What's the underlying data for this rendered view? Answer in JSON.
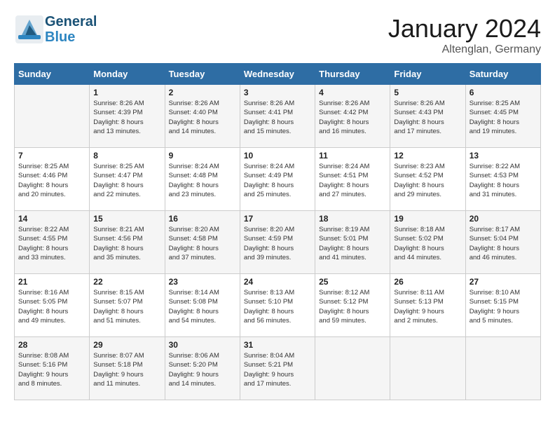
{
  "header": {
    "logo_line1": "General",
    "logo_line2": "Blue",
    "month": "January 2024",
    "location": "Altenglan, Germany"
  },
  "days_of_week": [
    "Sunday",
    "Monday",
    "Tuesday",
    "Wednesday",
    "Thursday",
    "Friday",
    "Saturday"
  ],
  "weeks": [
    [
      {
        "day": "",
        "info": ""
      },
      {
        "day": "1",
        "info": "Sunrise: 8:26 AM\nSunset: 4:39 PM\nDaylight: 8 hours\nand 13 minutes."
      },
      {
        "day": "2",
        "info": "Sunrise: 8:26 AM\nSunset: 4:40 PM\nDaylight: 8 hours\nand 14 minutes."
      },
      {
        "day": "3",
        "info": "Sunrise: 8:26 AM\nSunset: 4:41 PM\nDaylight: 8 hours\nand 15 minutes."
      },
      {
        "day": "4",
        "info": "Sunrise: 8:26 AM\nSunset: 4:42 PM\nDaylight: 8 hours\nand 16 minutes."
      },
      {
        "day": "5",
        "info": "Sunrise: 8:26 AM\nSunset: 4:43 PM\nDaylight: 8 hours\nand 17 minutes."
      },
      {
        "day": "6",
        "info": "Sunrise: 8:25 AM\nSunset: 4:45 PM\nDaylight: 8 hours\nand 19 minutes."
      }
    ],
    [
      {
        "day": "7",
        "info": "Sunrise: 8:25 AM\nSunset: 4:46 PM\nDaylight: 8 hours\nand 20 minutes."
      },
      {
        "day": "8",
        "info": "Sunrise: 8:25 AM\nSunset: 4:47 PM\nDaylight: 8 hours\nand 22 minutes."
      },
      {
        "day": "9",
        "info": "Sunrise: 8:24 AM\nSunset: 4:48 PM\nDaylight: 8 hours\nand 23 minutes."
      },
      {
        "day": "10",
        "info": "Sunrise: 8:24 AM\nSunset: 4:49 PM\nDaylight: 8 hours\nand 25 minutes."
      },
      {
        "day": "11",
        "info": "Sunrise: 8:24 AM\nSunset: 4:51 PM\nDaylight: 8 hours\nand 27 minutes."
      },
      {
        "day": "12",
        "info": "Sunrise: 8:23 AM\nSunset: 4:52 PM\nDaylight: 8 hours\nand 29 minutes."
      },
      {
        "day": "13",
        "info": "Sunrise: 8:22 AM\nSunset: 4:53 PM\nDaylight: 8 hours\nand 31 minutes."
      }
    ],
    [
      {
        "day": "14",
        "info": "Sunrise: 8:22 AM\nSunset: 4:55 PM\nDaylight: 8 hours\nand 33 minutes."
      },
      {
        "day": "15",
        "info": "Sunrise: 8:21 AM\nSunset: 4:56 PM\nDaylight: 8 hours\nand 35 minutes."
      },
      {
        "day": "16",
        "info": "Sunrise: 8:20 AM\nSunset: 4:58 PM\nDaylight: 8 hours\nand 37 minutes."
      },
      {
        "day": "17",
        "info": "Sunrise: 8:20 AM\nSunset: 4:59 PM\nDaylight: 8 hours\nand 39 minutes."
      },
      {
        "day": "18",
        "info": "Sunrise: 8:19 AM\nSunset: 5:01 PM\nDaylight: 8 hours\nand 41 minutes."
      },
      {
        "day": "19",
        "info": "Sunrise: 8:18 AM\nSunset: 5:02 PM\nDaylight: 8 hours\nand 44 minutes."
      },
      {
        "day": "20",
        "info": "Sunrise: 8:17 AM\nSunset: 5:04 PM\nDaylight: 8 hours\nand 46 minutes."
      }
    ],
    [
      {
        "day": "21",
        "info": "Sunrise: 8:16 AM\nSunset: 5:05 PM\nDaylight: 8 hours\nand 49 minutes."
      },
      {
        "day": "22",
        "info": "Sunrise: 8:15 AM\nSunset: 5:07 PM\nDaylight: 8 hours\nand 51 minutes."
      },
      {
        "day": "23",
        "info": "Sunrise: 8:14 AM\nSunset: 5:08 PM\nDaylight: 8 hours\nand 54 minutes."
      },
      {
        "day": "24",
        "info": "Sunrise: 8:13 AM\nSunset: 5:10 PM\nDaylight: 8 hours\nand 56 minutes."
      },
      {
        "day": "25",
        "info": "Sunrise: 8:12 AM\nSunset: 5:12 PM\nDaylight: 8 hours\nand 59 minutes."
      },
      {
        "day": "26",
        "info": "Sunrise: 8:11 AM\nSunset: 5:13 PM\nDaylight: 9 hours\nand 2 minutes."
      },
      {
        "day": "27",
        "info": "Sunrise: 8:10 AM\nSunset: 5:15 PM\nDaylight: 9 hours\nand 5 minutes."
      }
    ],
    [
      {
        "day": "28",
        "info": "Sunrise: 8:08 AM\nSunset: 5:16 PM\nDaylight: 9 hours\nand 8 minutes."
      },
      {
        "day": "29",
        "info": "Sunrise: 8:07 AM\nSunset: 5:18 PM\nDaylight: 9 hours\nand 11 minutes."
      },
      {
        "day": "30",
        "info": "Sunrise: 8:06 AM\nSunset: 5:20 PM\nDaylight: 9 hours\nand 14 minutes."
      },
      {
        "day": "31",
        "info": "Sunrise: 8:04 AM\nSunset: 5:21 PM\nDaylight: 9 hours\nand 17 minutes."
      },
      {
        "day": "",
        "info": ""
      },
      {
        "day": "",
        "info": ""
      },
      {
        "day": "",
        "info": ""
      }
    ]
  ]
}
